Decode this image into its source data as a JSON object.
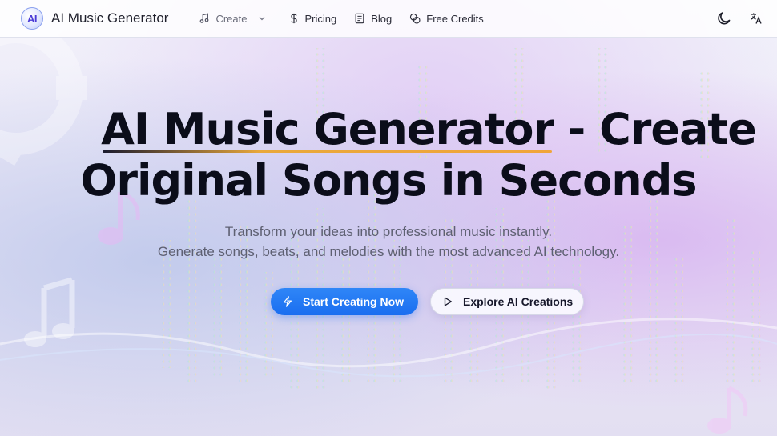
{
  "brand": {
    "logo_text": "AI",
    "name": "AI Music Generator"
  },
  "nav": {
    "items": [
      {
        "label": "Create",
        "icon": "music-note-icon",
        "has_dropdown": true
      },
      {
        "label": "Pricing",
        "icon": "dollar-icon"
      },
      {
        "label": "Blog",
        "icon": "document-icon"
      },
      {
        "label": "Free Credits",
        "icon": "coins-icon"
      }
    ],
    "right_icons": [
      "moon-icon",
      "translate-icon"
    ]
  },
  "hero": {
    "title_highlight": "AI Music Generator",
    "title_rest_1": " - Create",
    "title_line_2": "Original Songs in Seconds",
    "subtitle_line_1": "Transform your ideas into professional music instantly.",
    "subtitle_line_2": "Generate songs, beats, and melodies with the most advanced AI technology.",
    "primary_button": "Start Creating Now",
    "secondary_button": "Explore AI Creations"
  },
  "colors": {
    "primary": "#1a6ef0",
    "title": "#0b0d1a",
    "underline_accent": "#f0a53a"
  }
}
